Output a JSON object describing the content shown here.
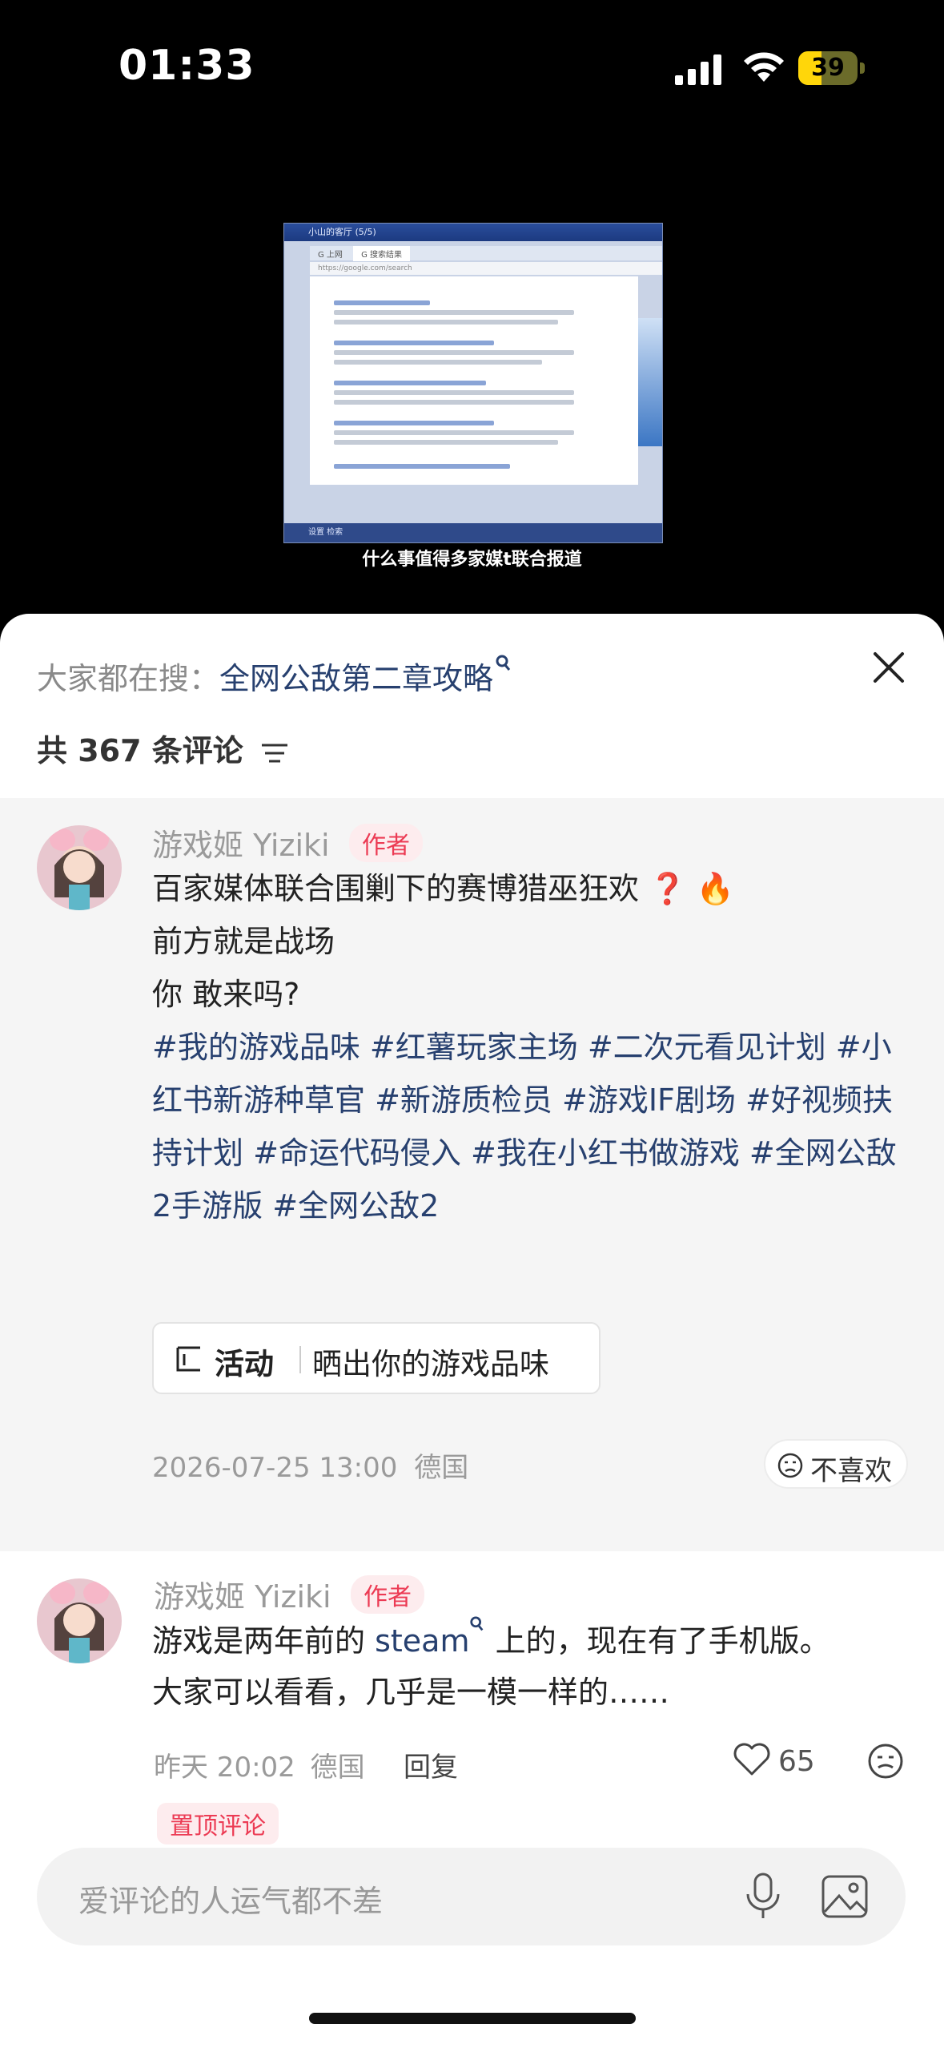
{
  "status_bar": {
    "time": "01:33",
    "battery": "39",
    "battery_level": 0.39
  },
  "video": {
    "caption": "什么事值得多家媒t联合报道",
    "window_title": "小山的客厅 (5/5)",
    "tab1": "G 上网",
    "tab2": "G 搜索结果",
    "footer": "设置  检索"
  },
  "sheet": {
    "search_prefix": "大家都在搜：",
    "search_keyword": "全网公敌第二章攻略",
    "comment_count_label": "共 367 条评论"
  },
  "pinned_comment": {
    "username": "游戏姬 Yiziki",
    "author_tag": "作者",
    "line1": "百家媒体联合围剿下的赛博猎巫狂欢 ❓ 🔥",
    "line2": "前方就是战场",
    "line3": "你 敢来吗?",
    "hashtags": "#我的游戏品味 #红薯玩家主场 #二次元看见计划 #小红书新游种草官 #新游质检员 #游戏IF剧场 #好视频扶持计划 #命运代码侵入 #我在小红书做游戏 #全网公敌2手游版 #全网公敌2",
    "activity_label": "活动",
    "activity_text": "晒出你的游戏品味",
    "time": "2026-07-25 13:00",
    "location": "德国",
    "dislike_label": "不喜欢"
  },
  "second_comment": {
    "username": "游戏姬 Yiziki",
    "author_tag": "作者",
    "text_a": "游戏是两年前的 ",
    "text_link": "steam",
    "text_b": " 上的，现在有了手机版。",
    "text_line2": "大家可以看看，几乎是一模一样的……",
    "time": "昨天 20:02",
    "location": "德国",
    "reply_label": "回复",
    "like_count": "65",
    "pinned_label": "置顶评论"
  },
  "input": {
    "placeholder": "爱评论的人运气都不差"
  },
  "icons": [
    "signal-icon",
    "wifi-icon",
    "battery-icon",
    "close-icon",
    "sort-icon",
    "search-icon",
    "activity-icon",
    "dislike-face-icon",
    "heart-icon",
    "emoji-icon",
    "mic-icon",
    "image-icon"
  ],
  "colors": {
    "hashtag": "#27406f",
    "author_tag_text": "#ec3b54",
    "author_tag_bg": "#fdecee",
    "battery": "#ffd60a"
  }
}
